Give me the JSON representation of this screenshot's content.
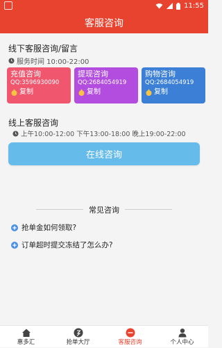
{
  "status_bar": {
    "time": "11:55"
  },
  "header": {
    "title": "客服咨询"
  },
  "offline": {
    "title": "线下客服咨询/留言",
    "service_time": "服务时间 10:00-22:00",
    "cards": [
      {
        "title": "充值咨询",
        "qq": "QQ:3596930090",
        "copy_label": "复制",
        "color": "#f0566e"
      },
      {
        "title": "提现咨询",
        "qq": "QQ:2684054919",
        "copy_label": "复制",
        "color": "#b24de0"
      },
      {
        "title": "购物咨询",
        "qq": "QQ:2684054919",
        "copy_label": "复制",
        "color": "#3b7fd6"
      }
    ]
  },
  "online": {
    "title": "线上客服咨询",
    "service_time": "上午10:00-12:00 下午13:00-18:00 晚上19:00-22:00",
    "button_label": "在线咨询"
  },
  "faq": {
    "title": "常见咨询",
    "items": [
      "抢单金如何领取?",
      "订单超时提交冻结了怎么办?"
    ]
  },
  "tabs": [
    {
      "label": "惠多汇",
      "icon": "home-icon"
    },
    {
      "label": "抢单大厅",
      "icon": "grab-order-icon"
    },
    {
      "label": "客服咨询",
      "icon": "customer-service-icon"
    },
    {
      "label": "个人中心",
      "icon": "person-icon"
    }
  ],
  "active_tab": 2,
  "colors": {
    "brand": "#e8432f",
    "button": "#65bbea"
  }
}
